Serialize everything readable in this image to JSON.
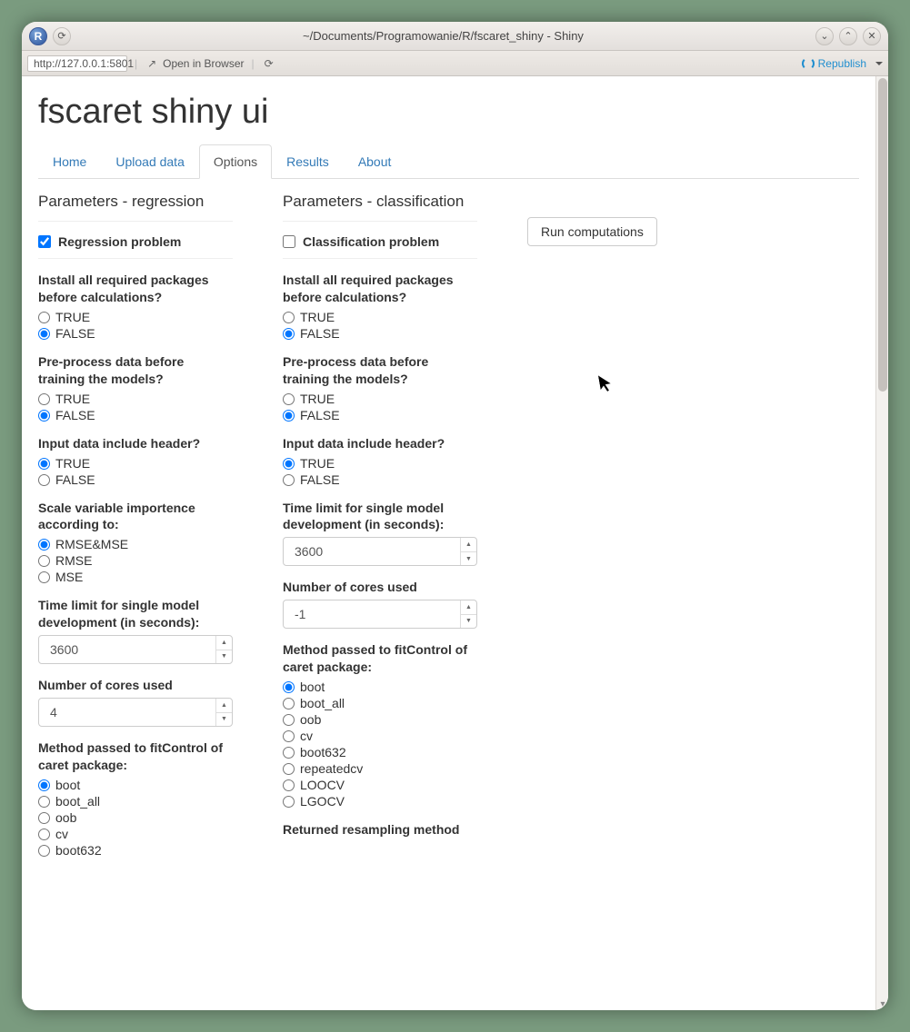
{
  "window": {
    "title": "~/Documents/Programowanie/R/fscaret_shiny - Shiny",
    "url": "http://127.0.0.1:5801",
    "open_in_browser": "Open in Browser",
    "republish": "Republish"
  },
  "app": {
    "title": "fscaret shiny ui",
    "tabs": [
      "Home",
      "Upload data",
      "Options",
      "Results",
      "About"
    ],
    "active_tab": "Options"
  },
  "regression": {
    "header": "Parameters - regression",
    "checkbox_label": "Regression problem",
    "checkbox_checked": true,
    "install_label": "Install all required packages before calculations?",
    "install_value": "FALSE",
    "preprocess_label": "Pre-process data before training the models?",
    "preprocess_value": "FALSE",
    "header_label": "Input data include header?",
    "header_value": "TRUE",
    "scale_label": "Scale variable importence according to:",
    "scale_options": [
      "RMSE&MSE",
      "RMSE",
      "MSE"
    ],
    "scale_value": "RMSE&MSE",
    "time_limit_label": "Time limit for single model development (in seconds):",
    "time_limit_value": "3600",
    "cores_label": "Number of cores used",
    "cores_value": "4",
    "method_label": "Method passed to fitControl of caret package:",
    "method_options": [
      "boot",
      "boot_all",
      "oob",
      "cv",
      "boot632"
    ],
    "method_value": "boot"
  },
  "classification": {
    "header": "Parameters - classification",
    "checkbox_label": "Classification problem",
    "checkbox_checked": false,
    "install_label": "Install all required packages before calculations?",
    "install_value": "FALSE",
    "preprocess_label": "Pre-process data before training the models?",
    "preprocess_value": "FALSE",
    "header_label": "Input data include header?",
    "header_value": "TRUE",
    "time_limit_label": "Time limit for single model development (in seconds):",
    "time_limit_value": "3600",
    "cores_label": "Number of cores used",
    "cores_value": "-1",
    "method_label": "Method passed to fitControl of caret package:",
    "method_options": [
      "boot",
      "boot_all",
      "oob",
      "cv",
      "boot632",
      "repeatedcv",
      "LOOCV",
      "LGOCV"
    ],
    "method_value": "boot",
    "returned_label": "Returned resampling method"
  },
  "bool_options": [
    "TRUE",
    "FALSE"
  ],
  "run_button": "Run computations"
}
